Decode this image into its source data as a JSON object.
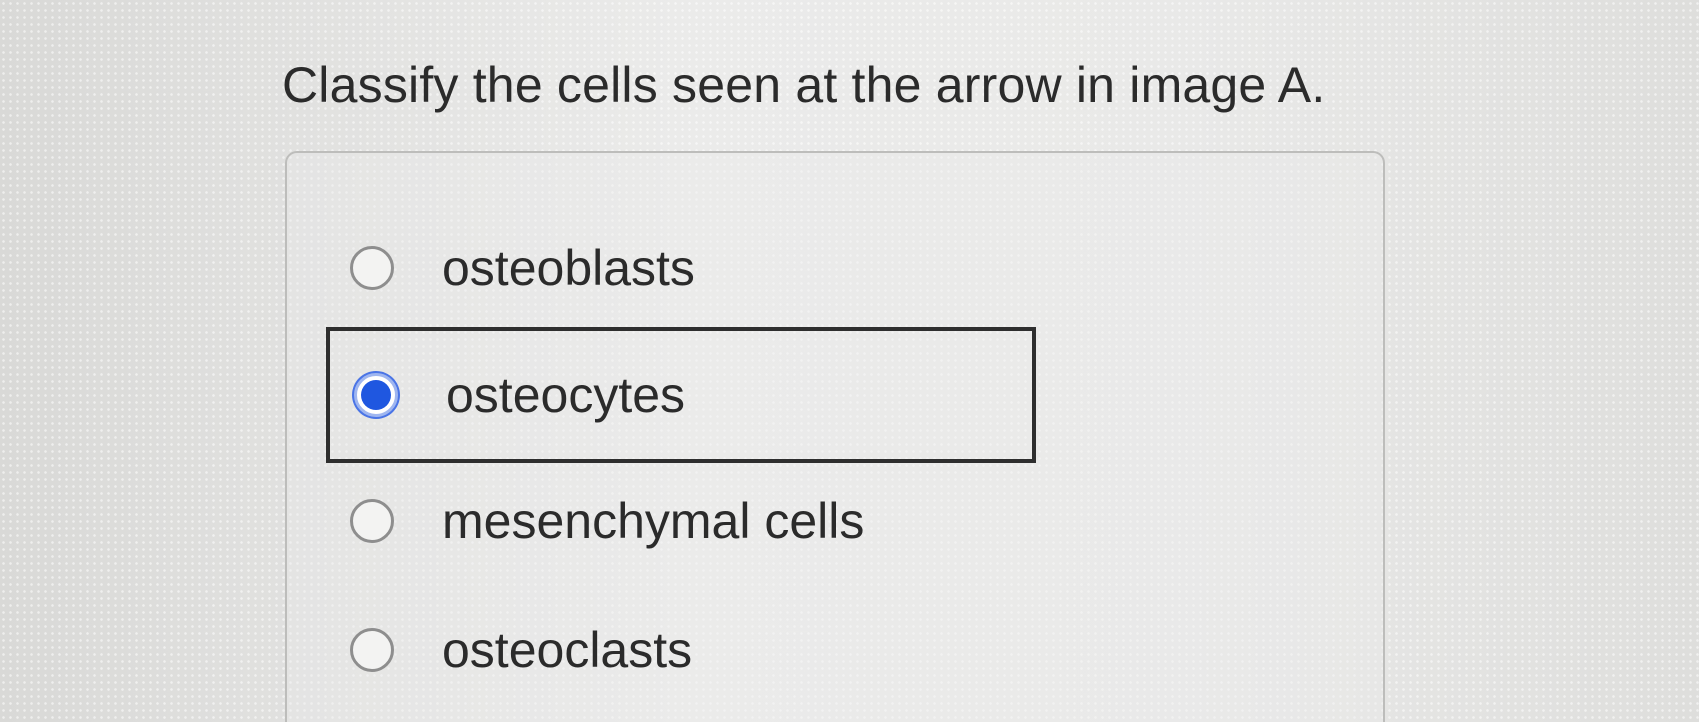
{
  "question": {
    "text": "Classify the cells seen at the arrow in image A."
  },
  "options": [
    {
      "label": "osteoblasts",
      "selected": false
    },
    {
      "label": "osteocytes",
      "selected": true
    },
    {
      "label": "mesenchymal cells",
      "selected": false
    },
    {
      "label": "osteoclasts",
      "selected": false
    }
  ],
  "colors": {
    "selected_radio": "#1f57e0",
    "selected_box_border": "#2e2e2e",
    "text": "#2b2b2b"
  }
}
